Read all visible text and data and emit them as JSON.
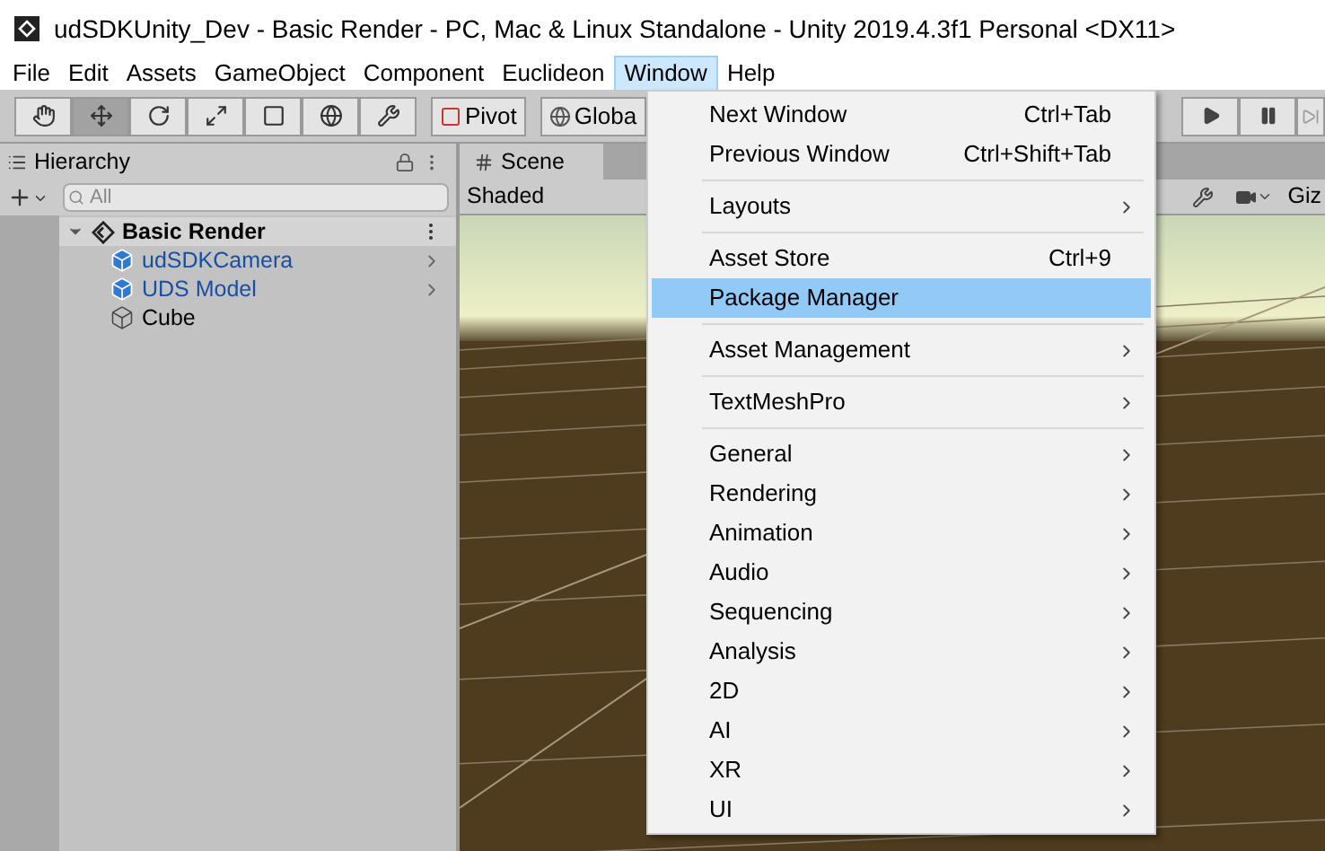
{
  "window": {
    "title": "udSDKUnity_Dev - Basic Render - PC, Mac & Linux Standalone - Unity 2019.4.3f1 Personal <DX11>"
  },
  "menu_bar": [
    {
      "label": "File",
      "selected": false
    },
    {
      "label": "Edit",
      "selected": false
    },
    {
      "label": "Assets",
      "selected": false
    },
    {
      "label": "GameObject",
      "selected": false
    },
    {
      "label": "Component",
      "selected": false
    },
    {
      "label": "Euclideon",
      "selected": false
    },
    {
      "label": "Window",
      "selected": true
    },
    {
      "label": "Help",
      "selected": false
    }
  ],
  "toolbar": {
    "tools": [
      {
        "kind": "hand",
        "selected": false
      },
      {
        "kind": "move",
        "selected": true
      },
      {
        "kind": "rotate",
        "selected": false
      },
      {
        "kind": "scale",
        "selected": false
      },
      {
        "kind": "rect",
        "selected": false
      },
      {
        "kind": "transform",
        "selected": false
      },
      {
        "kind": "custom",
        "selected": false
      }
    ],
    "pivot": "Pivot",
    "global": "Globa"
  },
  "hierarchy": {
    "tab": "Hierarchy",
    "search": {
      "placeholder": "All"
    },
    "items": [
      {
        "label": "Basic Render",
        "kind": "scene",
        "expanded": true,
        "selected": true,
        "children": [
          {
            "label": "udSDKCamera",
            "kind": "prefab",
            "submenu": true,
            "selected": false
          },
          {
            "label": "UDS Model",
            "kind": "prefab",
            "submenu": true,
            "selected": false
          },
          {
            "label": "Cube",
            "kind": "object",
            "submenu": false,
            "selected": false
          }
        ]
      }
    ]
  },
  "scene": {
    "tabs": [
      {
        "label": "Scene",
        "selected": true
      }
    ],
    "mode": "Shaded",
    "gizmos": "Giz"
  },
  "dropdown": {
    "groups": [
      [
        {
          "label": "Next Window",
          "shortcut": "Ctrl+Tab",
          "submenu": false,
          "selected": false
        },
        {
          "label": "Previous Window",
          "shortcut": "Ctrl+Shift+Tab",
          "submenu": false,
          "selected": false
        }
      ],
      [
        {
          "label": "Layouts",
          "submenu": true,
          "selected": false
        }
      ],
      [
        {
          "label": "Asset Store",
          "shortcut": "Ctrl+9",
          "submenu": false,
          "selected": false
        },
        {
          "label": "Package Manager",
          "submenu": false,
          "selected": true
        }
      ],
      [
        {
          "label": "Asset Management",
          "submenu": true,
          "selected": false
        }
      ],
      [
        {
          "label": "TextMeshPro",
          "submenu": true,
          "selected": false
        }
      ],
      [
        {
          "label": "General",
          "submenu": true,
          "selected": false
        },
        {
          "label": "Rendering",
          "submenu": true,
          "selected": false
        },
        {
          "label": "Animation",
          "submenu": true,
          "selected": false
        },
        {
          "label": "Audio",
          "submenu": true,
          "selected": false
        },
        {
          "label": "Sequencing",
          "submenu": true,
          "selected": false
        },
        {
          "label": "Analysis",
          "submenu": true,
          "selected": false
        },
        {
          "label": "2D",
          "submenu": true,
          "selected": false
        },
        {
          "label": "AI",
          "submenu": true,
          "selected": false
        },
        {
          "label": "XR",
          "submenu": true,
          "selected": false
        },
        {
          "label": "UI",
          "submenu": true,
          "selected": false
        }
      ]
    ]
  }
}
